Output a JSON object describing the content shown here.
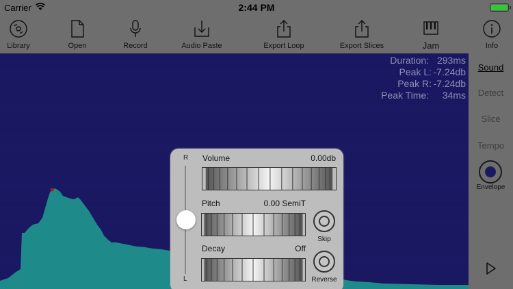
{
  "status": {
    "carrier": "Carrier",
    "time": "2:44 PM",
    "battery_level": 1.0
  },
  "toolbar": {
    "library": "Library",
    "open": "Open",
    "record": "Record",
    "audio_paste": "Audio Paste",
    "export_loop": "Export Loop",
    "export_slices": "Export Slices",
    "jam": "Jam",
    "info": "Info"
  },
  "info": {
    "duration_label": "Duration:",
    "duration_value": "293ms",
    "peak_l_label": "Peak L:",
    "peak_l_value": "-7.24db",
    "peak_r_label": "Peak R:",
    "peak_r_value": "-7.24db",
    "peak_time_label": "Peak Time:",
    "peak_time_value": "34ms"
  },
  "side": {
    "sound": "Sound",
    "detect": "Detect",
    "slice": "Slice",
    "tempo": "Tempo",
    "envelope": "Envelope"
  },
  "panel": {
    "pan_top": "R",
    "pan_bottom": "L",
    "volume_label": "Volume",
    "volume_value": "0.00db",
    "pitch_label": "Pitch",
    "pitch_value": "0.00 SemiT",
    "decay_label": "Decay",
    "decay_value": "Off",
    "skip_label": "Skip",
    "reverse_label": "Reverse"
  },
  "colors": {
    "waveform_fill": "#1f8a8a",
    "waveform_bg": "#1d1b66",
    "peak_marker": "#b01818"
  }
}
